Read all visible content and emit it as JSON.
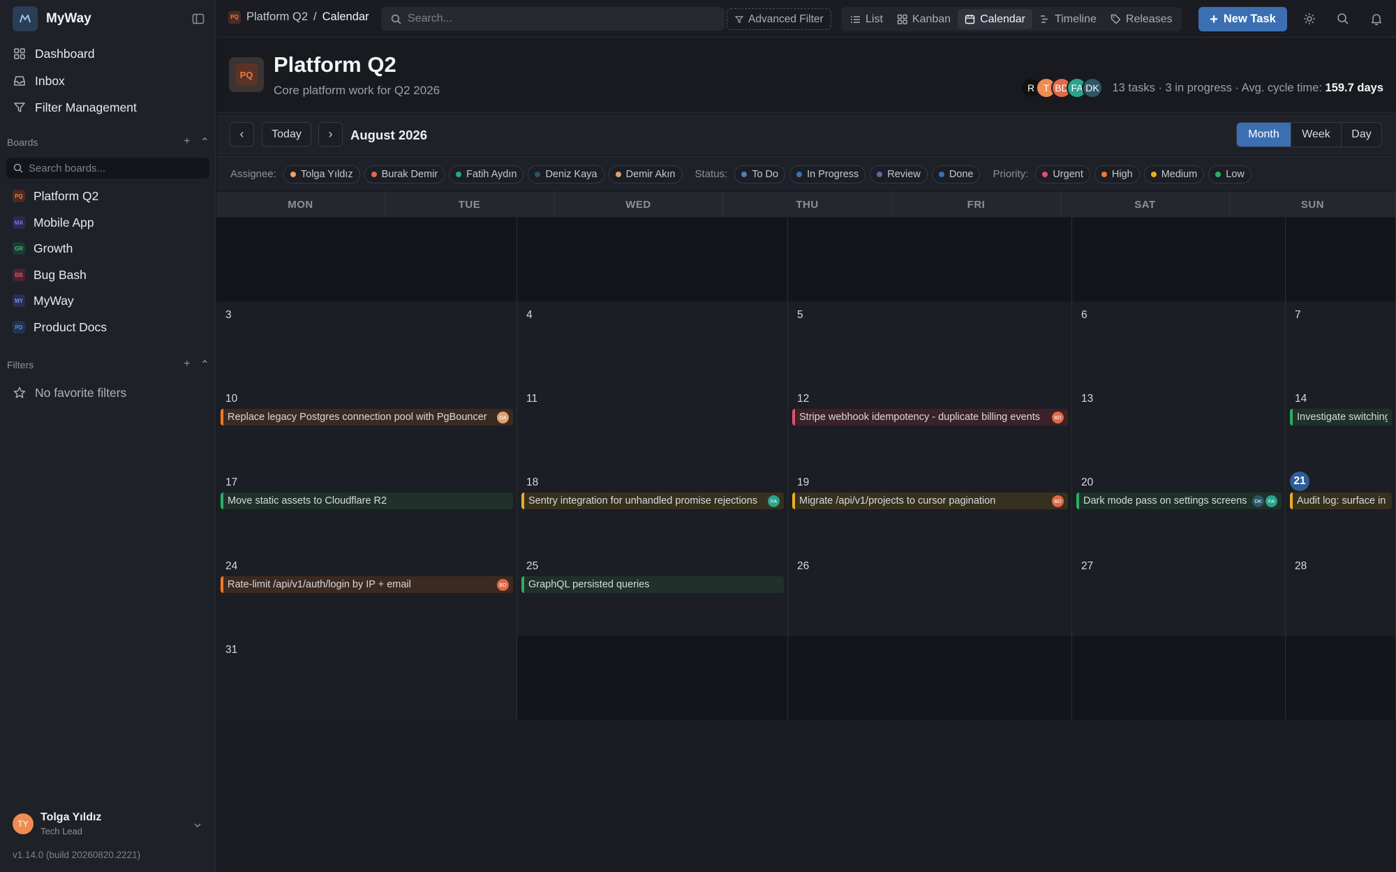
{
  "app": {
    "name": "MyWay",
    "version": "v1.14.0 (build 20260820.2221)"
  },
  "sidebar": {
    "nav": [
      {
        "label": "Dashboard",
        "icon": "grid-icon"
      },
      {
        "label": "Inbox",
        "icon": "inbox-icon"
      },
      {
        "label": "Filter Management",
        "icon": "filter-icon"
      }
    ],
    "boards_heading": "Boards",
    "boards_search_placeholder": "Search boards...",
    "boards": [
      {
        "label": "Platform Q2",
        "badge": "PQ",
        "color": "#f07a4a",
        "bg": "#4a2a22"
      },
      {
        "label": "Mobile App",
        "badge": "MA",
        "color": "#8b6cf0",
        "bg": "#2f2850"
      },
      {
        "label": "Growth",
        "badge": "GR",
        "color": "#3fbf7f",
        "bg": "#1f3a2f"
      },
      {
        "label": "Bug Bash",
        "badge": "BB",
        "color": "#e0506a",
        "bg": "#4a2230"
      },
      {
        "label": "MyWay",
        "badge": "MY",
        "color": "#7b8cf0",
        "bg": "#2a2f50"
      },
      {
        "label": "Product Docs",
        "badge": "PD",
        "color": "#4f8fe0",
        "bg": "#22344f"
      }
    ],
    "filters_heading": "Filters",
    "no_filters": "No favorite filters",
    "user": {
      "initials": "TY",
      "name": "Tolga Yıldız",
      "role": "Tech Lead"
    }
  },
  "topbar": {
    "breadcrumb": {
      "badge": "PQ",
      "project": "Platform Q2",
      "separator": "/",
      "current": "Calendar"
    },
    "search_placeholder": "Search...",
    "advanced_filter": "Advanced Filter",
    "views": [
      {
        "label": "List",
        "icon": "list-icon",
        "active": false
      },
      {
        "label": "Kanban",
        "icon": "kanban-icon",
        "active": false
      },
      {
        "label": "Calendar",
        "icon": "calendar-icon",
        "active": true
      },
      {
        "label": "Timeline",
        "icon": "timeline-icon",
        "active": false
      },
      {
        "label": "Releases",
        "icon": "tag-icon",
        "active": false
      }
    ],
    "new_task": "New Task"
  },
  "project": {
    "badge": "PQ",
    "title": "Platform Q2",
    "subtitle": "Core platform work for Q2 2026",
    "members": [
      {
        "initials": "R",
        "color": "#111111"
      },
      {
        "initials": "T",
        "color": "#ee8c52"
      },
      {
        "initials": "BD",
        "color": "#e06a4a"
      },
      {
        "initials": "FA",
        "color": "#2aa38a"
      },
      {
        "initials": "DK",
        "color": "#2d5566"
      }
    ],
    "stats_text": "13 tasks · 3 in progress · Avg. cycle time: ",
    "cycle_time": "159.7 days"
  },
  "calendar": {
    "month_label": "August 2026",
    "today_label": "Today",
    "prev_glyph": "‹",
    "next_glyph": "›",
    "ranges": [
      {
        "label": "Month",
        "active": true
      },
      {
        "label": "Week",
        "active": false
      },
      {
        "label": "Day",
        "active": false
      }
    ],
    "filters": {
      "assignee_label": "Assignee:",
      "assignees": [
        {
          "label": "Tolga Yıldız",
          "color": "#f0a060"
        },
        {
          "label": "Burak Demir",
          "color": "#e06a4a"
        },
        {
          "label": "Fatih Aydın",
          "color": "#2aa38a"
        },
        {
          "label": "Deniz Kaya",
          "color": "#2d5566"
        },
        {
          "label": "Demir Akın",
          "color": "#e0a070"
        }
      ],
      "status_label": "Status:",
      "statuses": [
        {
          "label": "To Do",
          "color": "#4f7fb8"
        },
        {
          "label": "In Progress",
          "color": "#3b6fb2"
        },
        {
          "label": "Review",
          "color": "#4f6fa0"
        },
        {
          "label": "Done",
          "color": "#3b6fb2"
        }
      ],
      "priority_label": "Priority:",
      "priorities": [
        {
          "label": "Urgent",
          "color": "#e0506a"
        },
        {
          "label": "High",
          "color": "#f07a2a"
        },
        {
          "label": "Medium",
          "color": "#e8b020"
        },
        {
          "label": "Low",
          "color": "#2ab060"
        }
      ]
    },
    "weekdays": [
      "MON",
      "TUE",
      "WED",
      "THU",
      "FRI",
      "SAT",
      "SUN"
    ],
    "weeks": [
      [
        "",
        "",
        "",
        "",
        "",
        "",
        ""
      ],
      [
        "3",
        "4",
        "5",
        "6",
        "7",
        "",
        ""
      ],
      [
        "10",
        "11",
        "12",
        "13",
        "14",
        "",
        ""
      ],
      [
        "17",
        "18",
        "19",
        "20",
        "21",
        "",
        ""
      ],
      [
        "24",
        "25",
        "26",
        "27",
        "28",
        "",
        ""
      ],
      [
        "31",
        "",
        "",
        "",
        "",
        "",
        ""
      ]
    ],
    "today": "21",
    "events": [
      {
        "week": 2,
        "col": 0,
        "title": "Replace legacy Postgres connection pool with PgBouncer",
        "avatars": [
          {
            "i": "DA",
            "c": "#e0a070"
          }
        ],
        "priority": "high"
      },
      {
        "week": 2,
        "col": 2,
        "title": "Stripe webhook idempotency - duplicate billing events",
        "avatars": [
          {
            "i": "BD",
            "c": "#e06a4a"
          }
        ],
        "priority": "urgent"
      },
      {
        "week": 2,
        "col": 4,
        "title": "Investigate switching",
        "avatars": [],
        "priority": "low"
      },
      {
        "week": 3,
        "col": 0,
        "title": "Move static assets to Cloudflare R2",
        "avatars": [],
        "priority": "low"
      },
      {
        "week": 3,
        "col": 1,
        "title": "Sentry integration for unhandled promise rejections",
        "avatars": [
          {
            "i": "FA",
            "c": "#2aa38a"
          }
        ],
        "priority": "medium"
      },
      {
        "week": 3,
        "col": 2,
        "title": "Migrate /api/v1/projects to cursor pagination",
        "avatars": [
          {
            "i": "BD",
            "c": "#e06a4a"
          }
        ],
        "priority": "medium"
      },
      {
        "week": 3,
        "col": 3,
        "title": "Dark mode pass on settings screens",
        "avatars": [
          {
            "i": "DK",
            "c": "#2d5566"
          },
          {
            "i": "FA",
            "c": "#2aa38a"
          }
        ],
        "priority": "low"
      },
      {
        "week": 3,
        "col": 4,
        "title": "Audit log: surface in a",
        "avatars": [],
        "priority": "medium"
      },
      {
        "week": 4,
        "col": 0,
        "title": "Rate-limit /api/v1/auth/login by IP + email",
        "avatars": [
          {
            "i": "BD",
            "c": "#e06a4a"
          }
        ],
        "priority": "high"
      },
      {
        "week": 4,
        "col": 1,
        "title": "GraphQL persisted queries",
        "avatars": [],
        "priority": "low"
      }
    ],
    "priority_colors": {
      "urgent": {
        "border": "#e0506a",
        "bg": "#3a2228"
      },
      "high": {
        "border": "#f07a2a",
        "bg": "#3a2a20"
      },
      "medium": {
        "border": "#e8b020",
        "bg": "#36301e"
      },
      "low": {
        "border": "#2ab060",
        "bg": "#1f3129"
      }
    }
  }
}
